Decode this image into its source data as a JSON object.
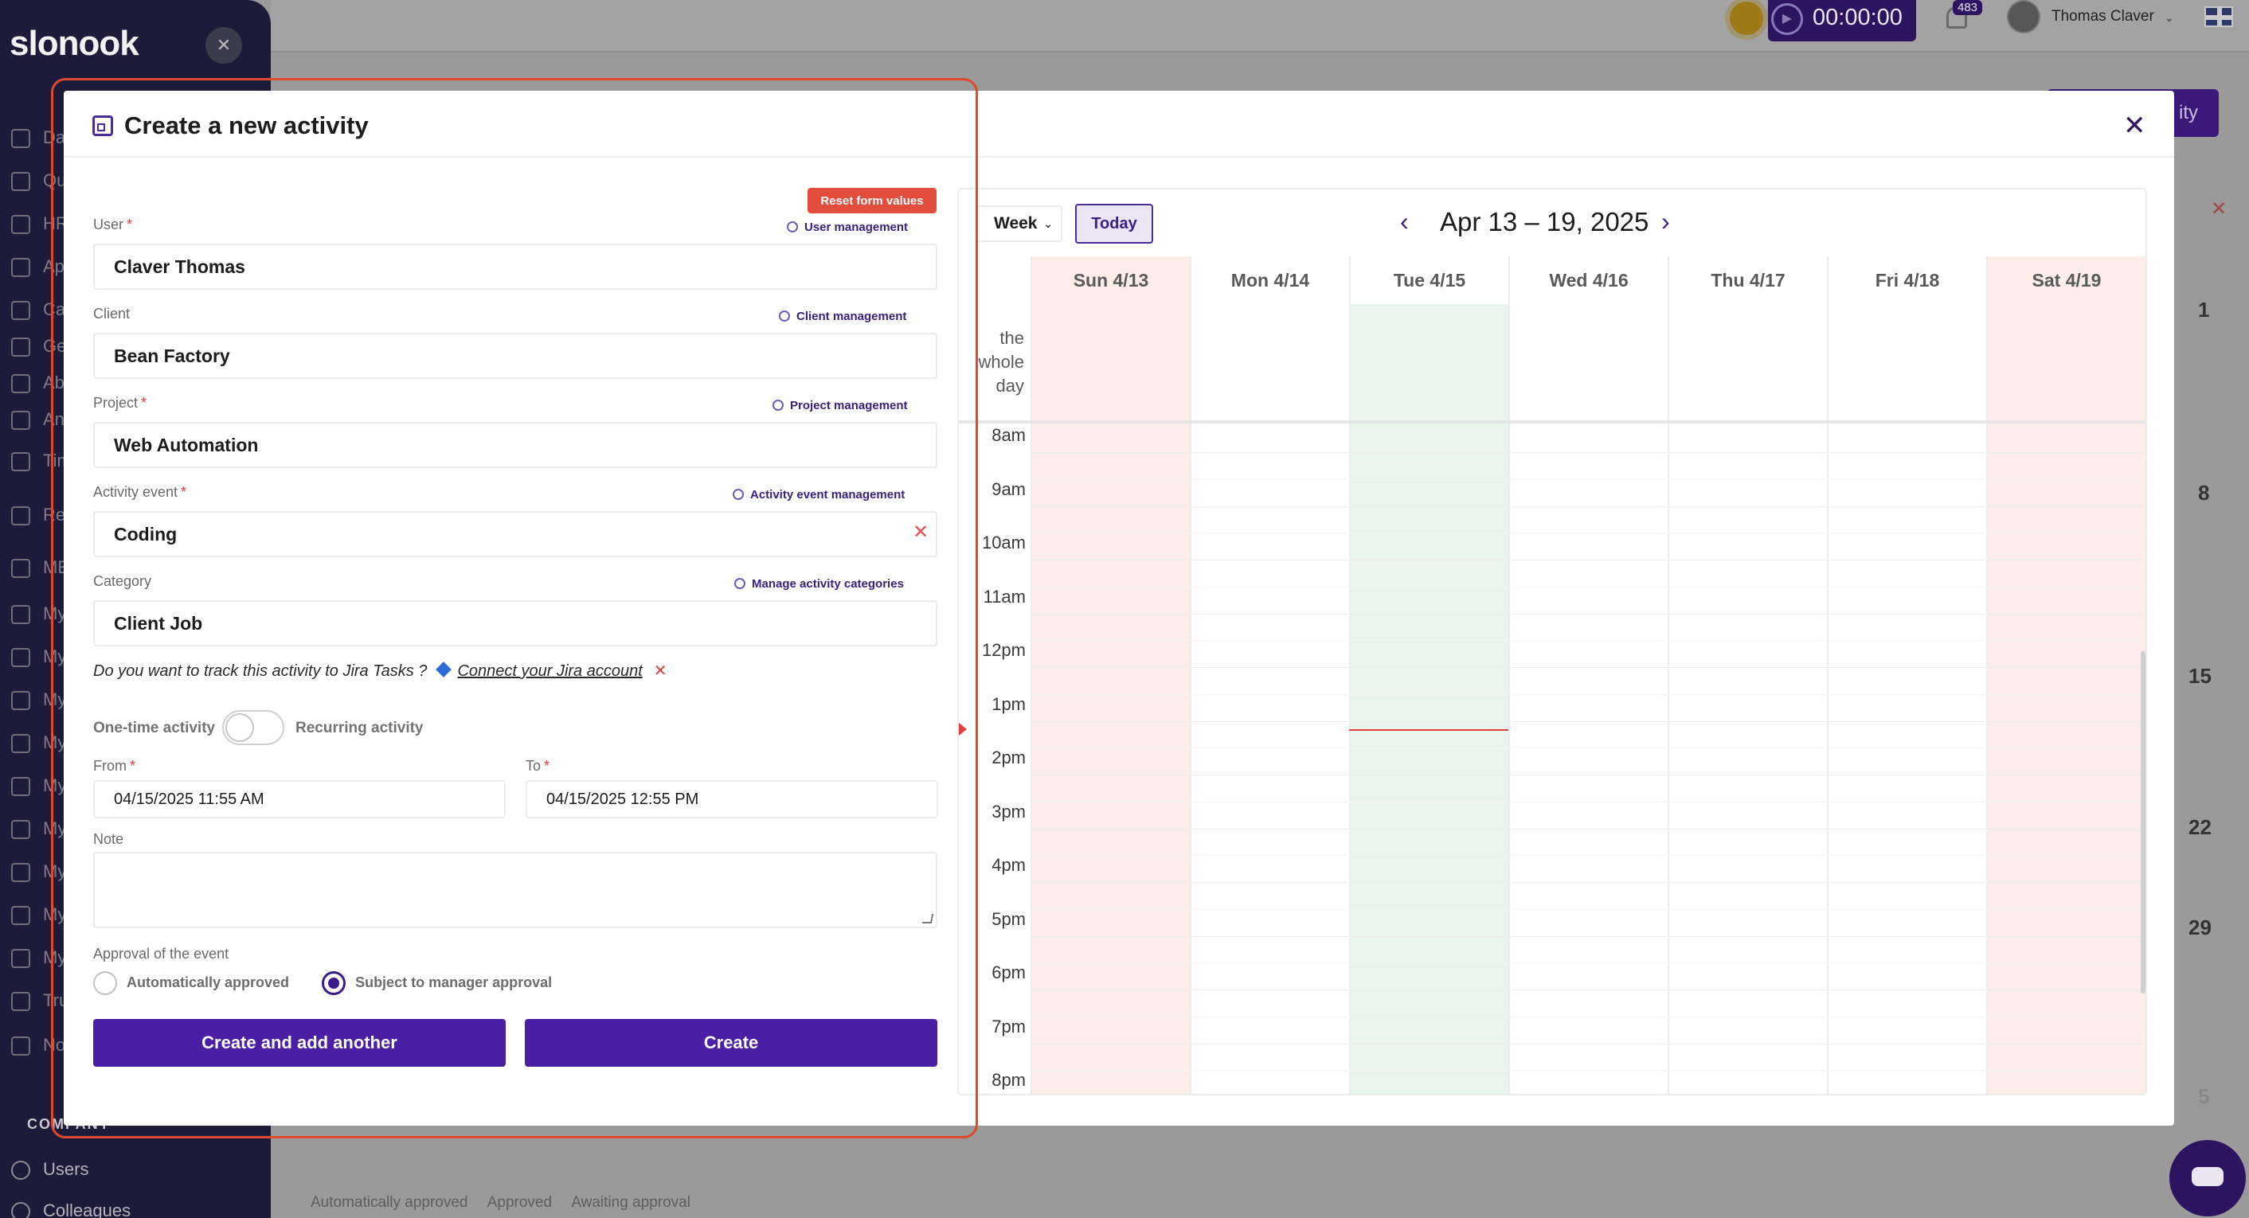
{
  "app": {
    "logo": "slonook",
    "timer": "00:00:00",
    "notifications": "483",
    "user_name": "Thomas Claver",
    "bg_add_label": "ity",
    "bg_numbers": [
      "1",
      "8",
      "15",
      "22",
      "29",
      "5"
    ],
    "legend": [
      "Automatically approved",
      "Approved",
      "Awaiting approval"
    ],
    "sidebar_items": [
      "Da",
      "Qu",
      "HR",
      "Ap",
      "Ca",
      "Ge",
      "Ab",
      "An",
      "Tim\nAct",
      "Re",
      "ME",
      "My",
      "My",
      "My",
      "My",
      "My",
      "My",
      "My",
      "My",
      "My",
      "Tru",
      "No\nInte"
    ],
    "sidebar_company": "COMPANY",
    "sidebar_bottom": [
      "Users",
      "Colleagues"
    ]
  },
  "modal": {
    "title": "Create a new activity",
    "reset_label": "Reset form values",
    "fields": {
      "user": {
        "label": "User",
        "value": "Claver Thomas",
        "link": "User management"
      },
      "client": {
        "label": "Client",
        "value": "Bean Factory",
        "link": "Client management"
      },
      "project": {
        "label": "Project",
        "value": "Web Automation",
        "link": "Project management"
      },
      "event": {
        "label": "Activity event",
        "value": "Coding",
        "link": "Activity event management"
      },
      "category": {
        "label": "Category",
        "value": "Client Job",
        "link": "Manage activity categories"
      }
    },
    "jira": {
      "question": "Do you want to track this activity to Jira Tasks ?",
      "link": "Connect your Jira account"
    },
    "toggle": {
      "left": "One-time activity",
      "right": "Recurring activity"
    },
    "from": {
      "label": "From",
      "value": "04/15/2025 11:55 AM"
    },
    "to": {
      "label": "To",
      "value": "04/15/2025 12:55 PM"
    },
    "note_label": "Note",
    "approval": {
      "label": "Approval of the event",
      "auto": "Automatically approved",
      "manager": "Subject to manager approval",
      "selected": "manager"
    },
    "btn_another": "Create and add another",
    "btn_create": "Create"
  },
  "calendar": {
    "view": "Week",
    "today": "Today",
    "range": "Apr 13 – 19, 2025",
    "days": [
      "Sun 4/13",
      "Mon 4/14",
      "Tue 4/15",
      "Wed 4/16",
      "Thu 4/17",
      "Fri 4/18",
      "Sat 4/19"
    ],
    "allday_label": [
      "the",
      "whole",
      "day"
    ],
    "hours": [
      "8am",
      "9am",
      "10am",
      "11am",
      "12pm",
      "1pm",
      "2pm",
      "3pm",
      "4pm",
      "5pm",
      "6pm",
      "7pm",
      "8pm"
    ]
  }
}
